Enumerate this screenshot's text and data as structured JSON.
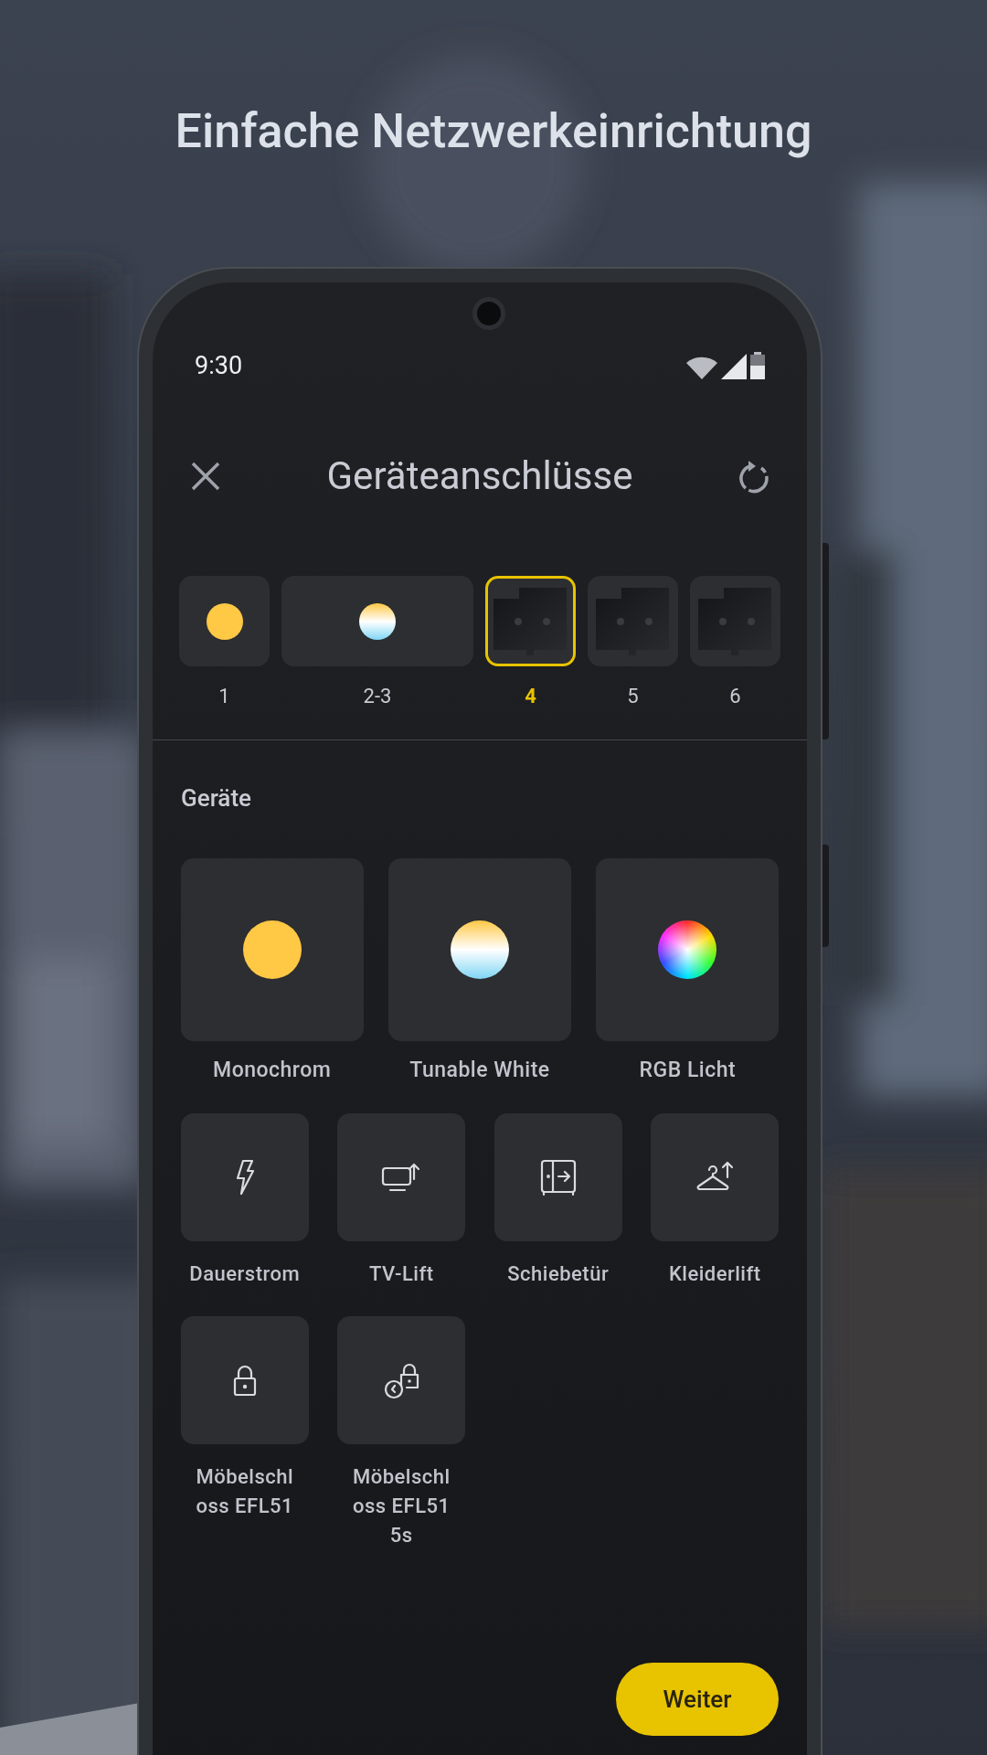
{
  "headline": "Einfache Netzwerkeinrichtung",
  "status_bar": {
    "time": "9:30"
  },
  "header": {
    "title": "Geräteanschlüsse"
  },
  "channels": [
    {
      "label": "1",
      "kind": "mono",
      "selected": false
    },
    {
      "label": "2-3",
      "kind": "tunable",
      "selected": false
    },
    {
      "label": "4",
      "kind": "socket",
      "selected": true
    },
    {
      "label": "5",
      "kind": "socket",
      "selected": false
    },
    {
      "label": "6",
      "kind": "socket",
      "selected": false
    }
  ],
  "section_title": "Geräte",
  "lights": [
    {
      "label": "Monochrom",
      "kind": "mono"
    },
    {
      "label": "Tunable White",
      "kind": "tunable"
    },
    {
      "label": "RGB Licht",
      "kind": "rgb"
    }
  ],
  "devices": [
    {
      "label": "Dauerstrom",
      "kind": "power"
    },
    {
      "label": "TV-Lift",
      "kind": "tv_lift"
    },
    {
      "label": "Schiebetür",
      "kind": "sliding_door"
    },
    {
      "label": "Kleiderlift",
      "kind": "clothes_lift"
    },
    {
      "label": "Möbelschloss EFL51",
      "kind": "lock"
    },
    {
      "label": "Möbelschloss EFL51 5s",
      "kind": "lock_timer"
    }
  ],
  "button": {
    "label": "Weiter"
  }
}
